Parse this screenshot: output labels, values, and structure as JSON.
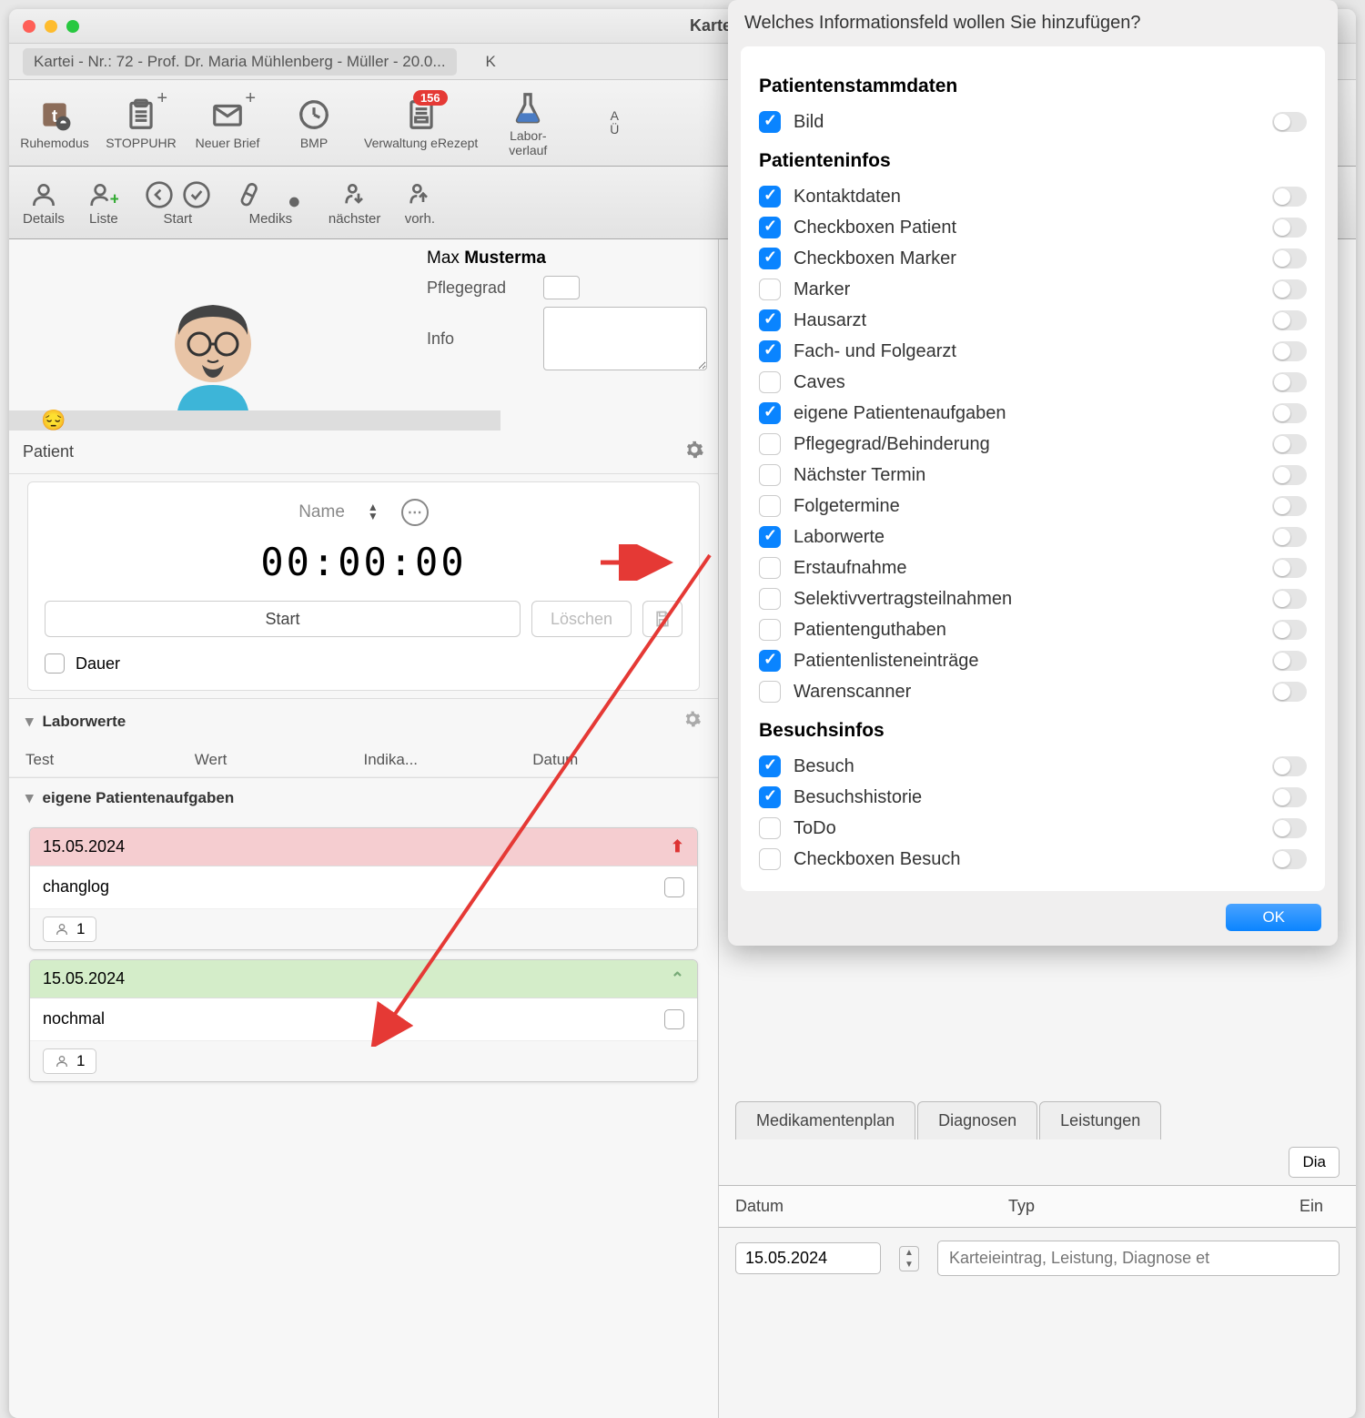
{
  "window": {
    "title": "Karte"
  },
  "tabbar": {
    "active": "Kartei - Nr.: 72 - Prof. Dr. Maria Mühlenberg - Müller - 20.0...",
    "second": "K"
  },
  "toolbar1": [
    {
      "label": "Ruhemodus"
    },
    {
      "label": "STOPPUHR"
    },
    {
      "label": "Neuer Brief"
    },
    {
      "label": "BMP"
    },
    {
      "label": "Verwaltung eRezept",
      "badge": "156"
    },
    {
      "label": "Labor-\nverlauf"
    },
    {
      "label": "A\nÜ"
    }
  ],
  "toolbar2": {
    "details": "Details",
    "liste": "Liste",
    "start": "Start",
    "mediks": "Mediks",
    "naechster": "nächster",
    "vorh": "vorh."
  },
  "patient": {
    "section_label": "Patient",
    "vlabel": "Patient",
    "name_prefix": "Max ",
    "name_bold": "Musterma",
    "pflegegrad_lbl": "Pflegegrad",
    "info_lbl": "Info"
  },
  "emoji": "😔",
  "stoppuhr": {
    "name_lbl": "Name",
    "timer": "00:00:00",
    "start": "Start",
    "loeschen": "Löschen",
    "dauer": "Dauer"
  },
  "labor": {
    "title": "Laborwerte",
    "cols": [
      "Test",
      "Wert",
      "Indika...",
      "Datum"
    ]
  },
  "tasks": {
    "title": "eigene Patientenaufgaben",
    "items": [
      {
        "date": "15.05.2024",
        "text": "changlog",
        "count": "1",
        "bg": "pink",
        "icon": "up"
      },
      {
        "date": "15.05.2024",
        "text": "nochmal",
        "count": "1",
        "bg": "green",
        "icon": "chev"
      }
    ]
  },
  "right": {
    "tabs": [
      "Medikamentenplan",
      "Diagnosen",
      "Leistungen"
    ],
    "dia": "Dia",
    "cols": [
      "Datum",
      "Typ",
      "Ein"
    ],
    "date": "15.05.2024",
    "placeholder": "Karteieintrag, Leistung, Diagnose et"
  },
  "dialog": {
    "title": "Welches Informationsfeld wollen Sie hinzufügen?",
    "sections": [
      {
        "name": "Patientenstammdaten",
        "items": [
          {
            "label": "Bild",
            "checked": true
          }
        ]
      },
      {
        "name": "Patienteninfos",
        "items": [
          {
            "label": "Kontaktdaten",
            "checked": true
          },
          {
            "label": "Checkboxen Patient",
            "checked": true
          },
          {
            "label": "Checkboxen Marker",
            "checked": true
          },
          {
            "label": "Marker",
            "checked": false
          },
          {
            "label": "Hausarzt",
            "checked": true
          },
          {
            "label": "Fach- und Folgearzt",
            "checked": true
          },
          {
            "label": "Caves",
            "checked": false
          },
          {
            "label": "eigene Patientenaufgaben",
            "checked": true
          },
          {
            "label": "Pflegegrad/Behinderung",
            "checked": false
          },
          {
            "label": "Nächster Termin",
            "checked": false
          },
          {
            "label": "Folgetermine",
            "checked": false
          },
          {
            "label": "Laborwerte",
            "checked": true
          },
          {
            "label": "Erstaufnahme",
            "checked": false
          },
          {
            "label": "Selektivvertragsteilnahmen",
            "checked": false
          },
          {
            "label": "Patientenguthaben",
            "checked": false
          },
          {
            "label": "Patientenlisteneinträge",
            "checked": true
          },
          {
            "label": "Warenscanner",
            "checked": false
          }
        ]
      },
      {
        "name": "Besuchsinfos",
        "items": [
          {
            "label": "Besuch",
            "checked": true
          },
          {
            "label": "Besuchshistorie",
            "checked": true
          },
          {
            "label": "ToDo",
            "checked": false
          },
          {
            "label": "Checkboxen Besuch",
            "checked": false
          }
        ]
      }
    ],
    "ok": "OK"
  }
}
